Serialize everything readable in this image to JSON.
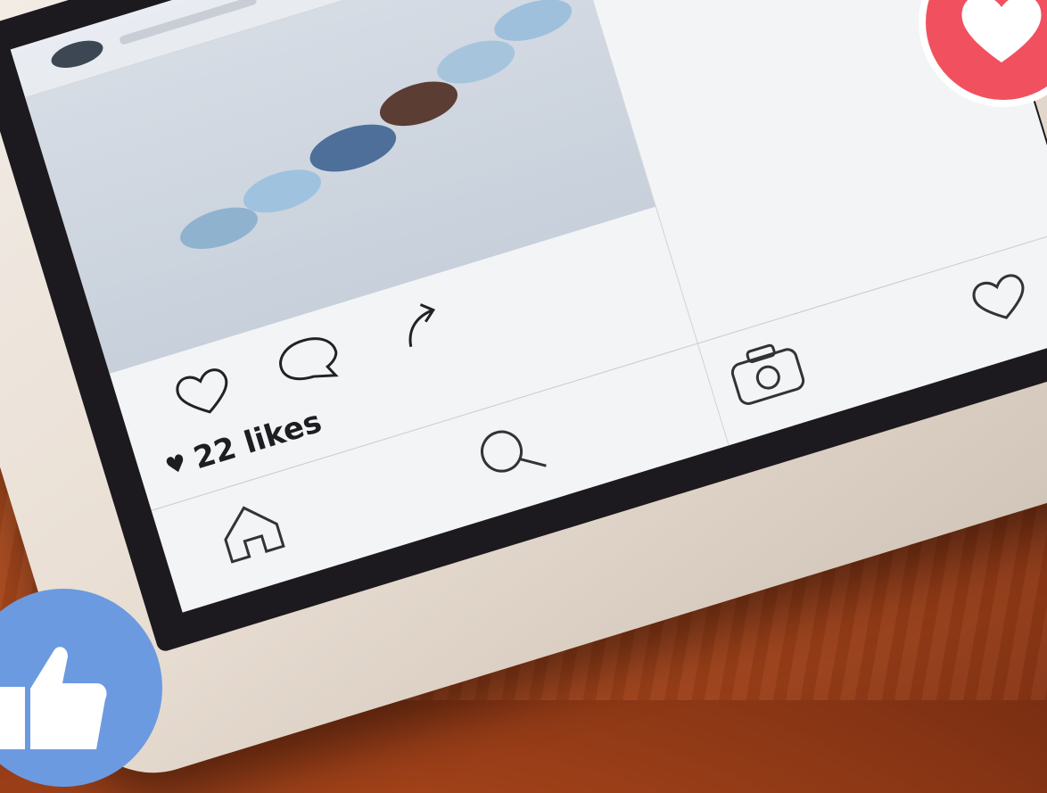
{
  "post": {
    "likes_label": "22 likes",
    "like_glyph": "♥"
  },
  "colors": {
    "love_badge": "#f1515f",
    "like_badge": "#6c9ae0",
    "screen_bg": "#f3f4f6",
    "bezel": "#1c1a1e"
  },
  "icons": {
    "action_row": [
      "heart-icon",
      "comment-icon",
      "share-icon"
    ],
    "nav_row": [
      "home-icon",
      "search-icon",
      "camera-icon",
      "heart-icon"
    ],
    "badges": [
      "love-reaction-icon",
      "thumbs-up-icon"
    ]
  }
}
